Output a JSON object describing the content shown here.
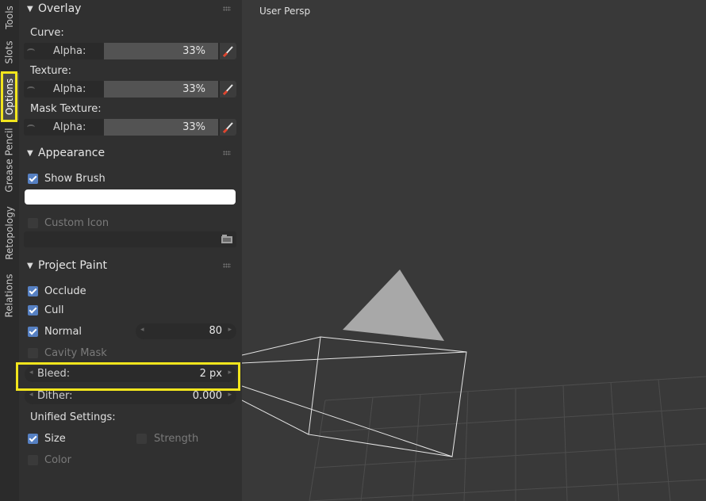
{
  "tabs": [
    {
      "label": "Tools",
      "active": false
    },
    {
      "label": "Slots",
      "active": false
    },
    {
      "label": "Options",
      "active": true
    },
    {
      "label": "Grease Pencil",
      "active": false
    },
    {
      "label": "Retopology",
      "active": false
    },
    {
      "label": "Relations",
      "active": false
    }
  ],
  "overlay": {
    "title": "Overlay",
    "curve_label": "Curve:",
    "texture_label": "Texture:",
    "mask_label": "Mask Texture:",
    "alpha_label": "Alpha:",
    "curve_alpha": "33%",
    "texture_alpha": "33%",
    "mask_alpha": "33%"
  },
  "appearance": {
    "title": "Appearance",
    "show_brush_label": "Show Brush",
    "show_brush_checked": true,
    "brush_color": "#ffffff",
    "custom_icon_label": "Custom Icon",
    "custom_icon_checked": false,
    "custom_icon_path": ""
  },
  "project_paint": {
    "title": "Project Paint",
    "occlude_label": "Occlude",
    "occlude_checked": true,
    "cull_label": "Cull",
    "cull_checked": true,
    "normal_label": "Normal",
    "normal_checked": true,
    "normal_value": "80",
    "cavity_label": "Cavity Mask",
    "cavity_checked": false,
    "bleed_label": "Bleed:",
    "bleed_value": "2 px",
    "dither_label": "Dither:",
    "dither_value": "0.000"
  },
  "unified": {
    "title": "Unified Settings:",
    "size_label": "Size",
    "size_checked": true,
    "strength_label": "Strength",
    "strength_checked": false,
    "color_label": "Color",
    "color_checked": false
  },
  "viewport": {
    "label": "User Persp"
  },
  "colors": {
    "highlight": "#f2e51d",
    "checkbox": "#5680c2",
    "panel_bg": "#303030",
    "viewport_bg": "#393939"
  }
}
